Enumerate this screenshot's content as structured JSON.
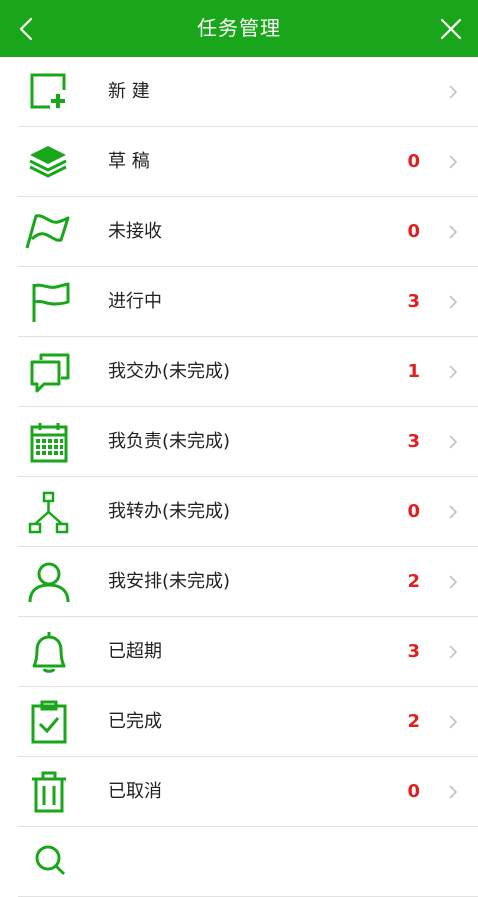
{
  "header": {
    "title": "任务管理"
  },
  "colors": {
    "brand": "#1aa61a",
    "count": "#e02020"
  },
  "items": [
    {
      "key": "new",
      "icon": "add-square-icon",
      "label": "新 建",
      "count": ""
    },
    {
      "key": "draft",
      "icon": "layers-icon",
      "label": "草 稿",
      "count": "0"
    },
    {
      "key": "unreceived",
      "icon": "wave-flag-icon",
      "label": "未接收",
      "count": "0"
    },
    {
      "key": "inprogress",
      "icon": "flag-icon",
      "label": "进行中",
      "count": "3"
    },
    {
      "key": "assigned",
      "icon": "chat-bubbles-icon",
      "label": "我交办(未完成)",
      "count": "1"
    },
    {
      "key": "responsible",
      "icon": "calendar-icon",
      "label": "我负责(未完成)",
      "count": "3"
    },
    {
      "key": "transferred",
      "icon": "org-chart-icon",
      "label": "我转办(未完成)",
      "count": "0"
    },
    {
      "key": "arranged",
      "icon": "user-icon",
      "label": "我安排(未完成)",
      "count": "2"
    },
    {
      "key": "overdue",
      "icon": "bell-icon",
      "label": "已超期",
      "count": "3"
    },
    {
      "key": "completed",
      "icon": "clipboard-check-icon",
      "label": "已完成",
      "count": "2"
    },
    {
      "key": "cancelled",
      "icon": "trash-icon",
      "label": "已取消",
      "count": "0"
    },
    {
      "key": "more",
      "icon": "search-icon",
      "label": "",
      "count": ""
    }
  ]
}
